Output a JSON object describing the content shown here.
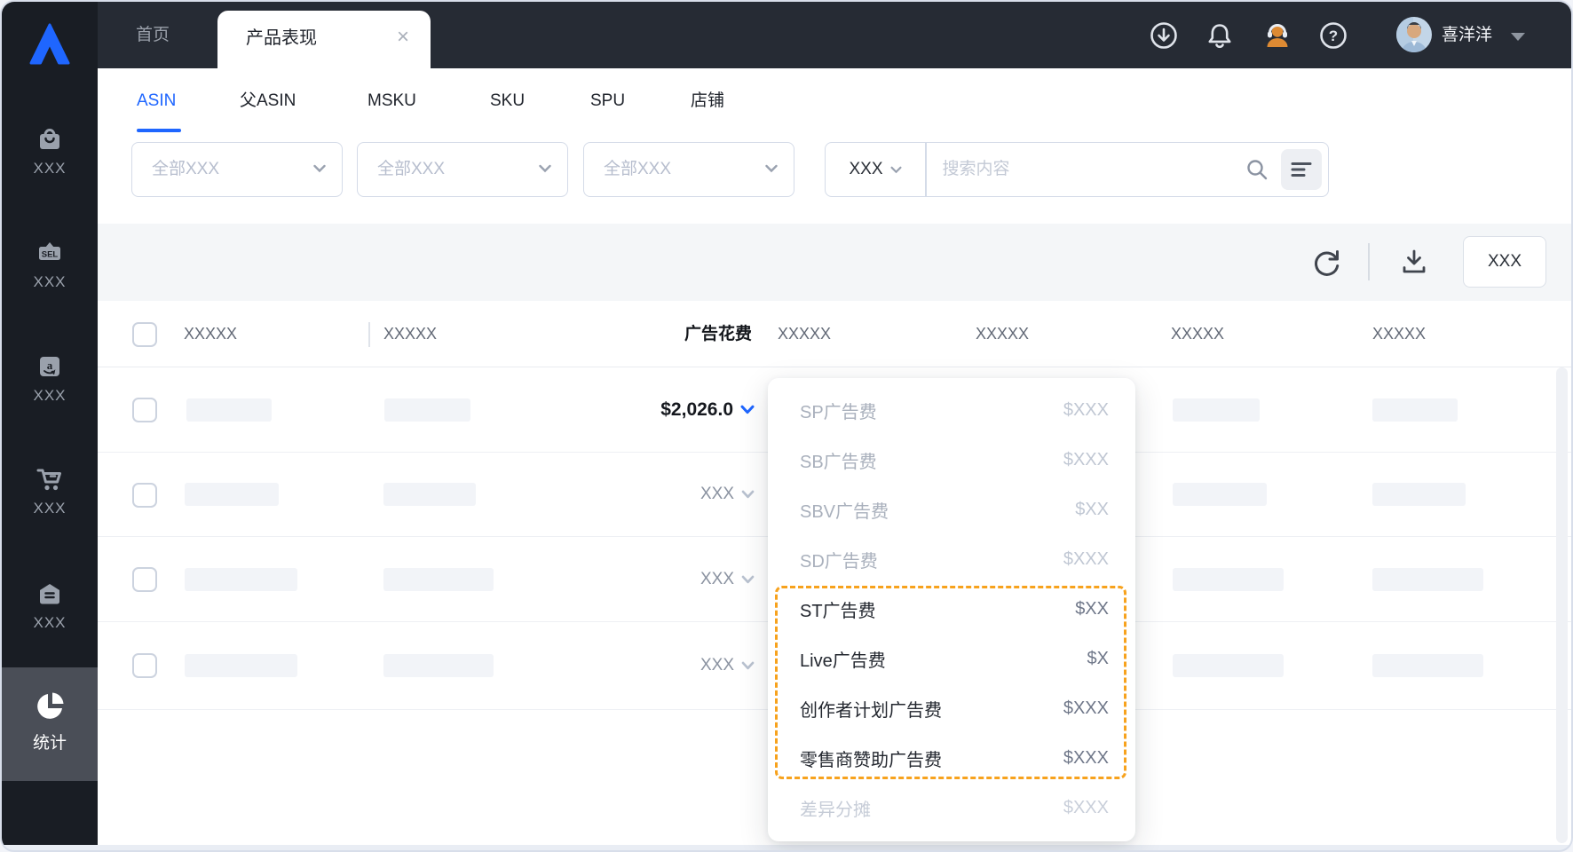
{
  "topbar": {
    "home_tab": "首页",
    "active_tab": {
      "title": "产品表现",
      "close": "×"
    },
    "user": {
      "name": "喜洋洋"
    }
  },
  "sidebar": {
    "items": [
      {
        "icon": "bag-icon",
        "label": "XXX"
      },
      {
        "icon": "seller-badge-icon",
        "label": "XXX"
      },
      {
        "icon": "amazon-icon",
        "label": "XXX"
      },
      {
        "icon": "cart-icon",
        "label": "XXX"
      },
      {
        "icon": "mailbox-icon",
        "label": "XXX"
      }
    ],
    "active_item": {
      "icon": "pie-chart-icon",
      "label": "统计"
    }
  },
  "tabs": {
    "items": [
      {
        "label": "ASIN",
        "active": true
      },
      {
        "label": "父ASIN",
        "active": false
      },
      {
        "label": "MSKU",
        "active": false
      },
      {
        "label": "SKU",
        "active": false
      },
      {
        "label": "SPU",
        "active": false
      },
      {
        "label": "店铺",
        "active": false
      }
    ]
  },
  "filters": {
    "selects": [
      {
        "value": "全部XXX"
      },
      {
        "value": "全部XXX"
      },
      {
        "value": "全部XXX"
      }
    ],
    "keyword_type": {
      "value": "XXX"
    },
    "search": {
      "placeholder": "搜索内容",
      "value": ""
    }
  },
  "toolbar": {
    "action_label": "XXX"
  },
  "table": {
    "headers": [
      "XXXXX",
      "XXXXX",
      "广告花费",
      "XXXXX",
      "XXXXX",
      "XXXXX",
      "XXXXX"
    ],
    "rows": [
      {
        "ad_spend": "$2,026.0",
        "expanded": true
      },
      {
        "ad_spend": "XXX",
        "expanded": false
      },
      {
        "ad_spend": "XXX",
        "expanded": false
      },
      {
        "ad_spend": "XXX",
        "expanded": false
      }
    ]
  },
  "spend_breakdown": {
    "items": [
      {
        "label": "SP广告费",
        "value": "$XXX",
        "style": "muted"
      },
      {
        "label": "SB广告费",
        "value": "$XXX",
        "style": "muted"
      },
      {
        "label": "SBV广告费",
        "value": "$XX",
        "style": "muted"
      },
      {
        "label": "SD广告费",
        "value": "$XXX",
        "style": "muted"
      },
      {
        "label": "ST广告费",
        "value": "$XX",
        "style": "highlighted"
      },
      {
        "label": "Live广告费",
        "value": "$X",
        "style": "highlighted"
      },
      {
        "label": "创作者计划广告费",
        "value": "$XXX",
        "style": "highlighted"
      },
      {
        "label": "零售商赞助广告费",
        "value": "$XXX",
        "style": "highlighted"
      },
      {
        "label": "差异分摊",
        "value": "$XXX",
        "style": "disabled"
      }
    ]
  },
  "colors": {
    "accent_blue": "#1f66ff",
    "topbar_bg": "#262b34",
    "sidebar_bg": "#191d24",
    "sidebar_active_bg": "#4a4e57",
    "highlight_dash_orange": "#f7a21d",
    "headset_orange": "#dd8a33",
    "placeholder_bar": "#f2f4f8"
  }
}
